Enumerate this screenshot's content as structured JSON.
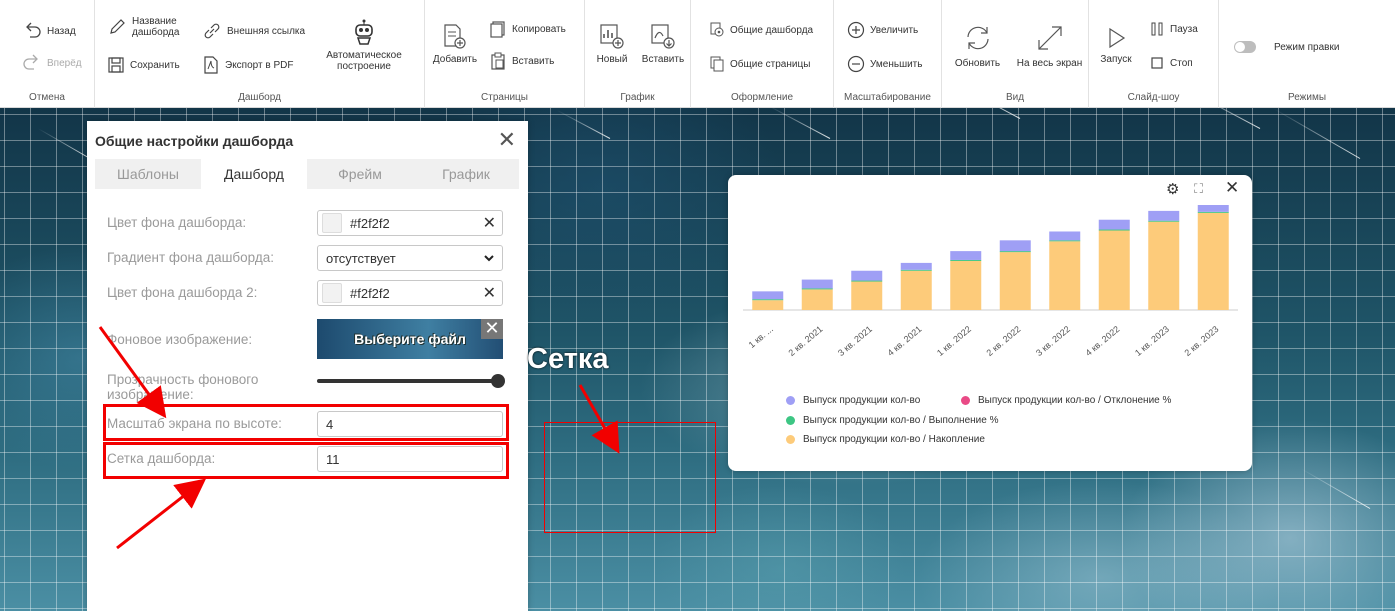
{
  "ribbon": {
    "undo": {
      "back": "Назад",
      "forward": "Вперёд",
      "label": "Отмена"
    },
    "dashboard": {
      "name": "Название дашборда",
      "external_link": "Внешняя ссылка",
      "save": "Сохранить",
      "export_pdf": "Экспорт в PDF",
      "auto_build": "Автоматическое построение",
      "label": "Дашборд"
    },
    "pages": {
      "add": "Добавить",
      "copy": "Копировать",
      "paste": "Вставить",
      "label": "Страницы"
    },
    "chart": {
      "new": "Новый",
      "paste": "Вставить",
      "label": "График"
    },
    "design": {
      "common_dashboards": "Общие дашборда",
      "common_pages": "Общие страницы",
      "label": "Оформление"
    },
    "zoom": {
      "increase": "Увеличить",
      "decrease": "Уменьшить",
      "label": "Масштабирование"
    },
    "view": {
      "refresh": "Обновить",
      "fullscreen": "На весь экран",
      "label": "Вид"
    },
    "slideshow": {
      "start": "Запуск",
      "pause": "Пауза",
      "stop": "Стоп",
      "label": "Слайд-шоу"
    },
    "modes": {
      "edit_mode": "Режим правки",
      "label": "Режимы"
    }
  },
  "panel": {
    "title": "Общие настройки дашборда",
    "tabs": [
      "Шаблоны",
      "Дашборд",
      "Фрейм",
      "График"
    ],
    "active_tab": "Дашборд",
    "fields": {
      "bg_color": {
        "label": "Цвет фона дашборда:",
        "value": "#f2f2f2"
      },
      "bg_gradient": {
        "label": "Градиент фона дашборда:",
        "value": "отсутствует"
      },
      "bg_color2": {
        "label": "Цвет фона дашборда 2:",
        "value": "#f2f2f2"
      },
      "bg_image": {
        "label": "Фоновое изображение:",
        "button": "Выберите файл"
      },
      "bg_opacity": {
        "label": "Прозрачность фонового изображение:",
        "value": 100
      },
      "screen_scale": {
        "label": "Масштаб экрана по высоте:",
        "value": "4"
      },
      "grid": {
        "label": "Сетка дашборда:",
        "value": "11"
      }
    }
  },
  "annotation": {
    "grid_label": "Сетка",
    "color": "#f20000"
  },
  "chart_data": {
    "type": "bar",
    "stacked": true,
    "categories": [
      "1 кв. ...",
      "2 кв. 2021",
      "3 кв. 2021",
      "4 кв. 2021",
      "1 кв. 2022",
      "2 кв. 2022",
      "3 кв. 2022",
      "4 кв. 2022",
      "1 кв. 2023",
      "2 кв. 2023"
    ],
    "series": [
      {
        "name": "Выпуск продукции кол-во",
        "color": "#9f9ff5",
        "values": [
          8,
          9,
          10,
          7,
          9,
          11,
          9,
          10,
          10,
          7
        ]
      },
      {
        "name": "Выпуск продукции кол-во / Отклонение %",
        "color": "#e94a86",
        "values": [
          0,
          0,
          0,
          0,
          0,
          0,
          0,
          0,
          0,
          0
        ]
      },
      {
        "name": "Выпуск продукции кол-во / Выполнение %",
        "color": "#3dc684",
        "values": [
          1,
          1,
          1,
          1,
          1,
          1,
          1,
          1,
          1,
          1
        ]
      },
      {
        "name": "Выпуск продукции кол-во / Накопление",
        "color": "#fdcb7a",
        "values": [
          10,
          21,
          29,
          40,
          50,
          59,
          70,
          81,
          90,
          99
        ]
      }
    ]
  }
}
